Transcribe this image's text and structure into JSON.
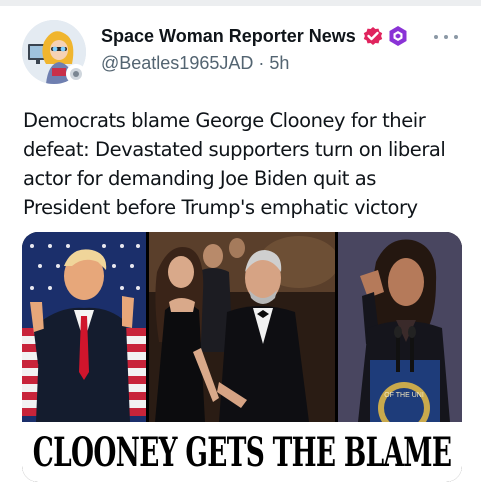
{
  "post": {
    "author": {
      "display_name": "Space Woman Reporter News",
      "handle": "@Beatles1965JAD",
      "separator": "·",
      "time": "5h",
      "verified_badge_color": "#e0245e",
      "affiliate_badge_color": "#8a33d6"
    },
    "text": "Democrats blame George Clooney for their defeat: Devastated supporters turn on liberal actor for demanding Joe Biden quit as President before Trump's emphatic victory",
    "media": {
      "headline": "CLOONEY GETS THE BLAME",
      "seal_text": "OF THE UNI"
    },
    "icons": {
      "more": "more-horizontal-icon",
      "verified": "verified-check-icon",
      "affiliate": "affiliate-hexagon-icon"
    }
  }
}
